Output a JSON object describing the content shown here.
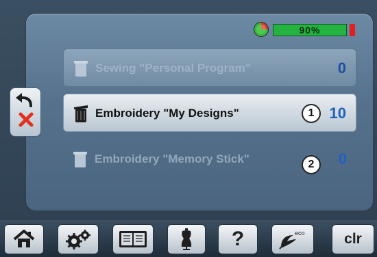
{
  "status": {
    "level_text": "90%",
    "level_fraction": 0.9
  },
  "memory_list": {
    "items": [
      {
        "label": "Sewing \"Personal Program\"",
        "count": "0",
        "state": "disabled"
      },
      {
        "label": "Embroidery \"My Designs\"",
        "count": "10",
        "state": "active"
      },
      {
        "label": "Embroidery \"Memory Stick\"",
        "count": "0",
        "state": "disabled"
      }
    ]
  },
  "callouts": [
    "1",
    "2"
  ],
  "toolbar": {
    "buttons": [
      {
        "icon": "home-icon"
      },
      {
        "icon": "settings-gears-icon"
      },
      {
        "icon": "tutorial-book-icon"
      },
      {
        "icon": "consultant-dressform-icon"
      },
      {
        "icon": "help-icon",
        "label": "?"
      },
      {
        "icon": "eco-icon",
        "label": "eco"
      },
      {
        "icon": "clear-icon",
        "label": "clr"
      }
    ]
  }
}
